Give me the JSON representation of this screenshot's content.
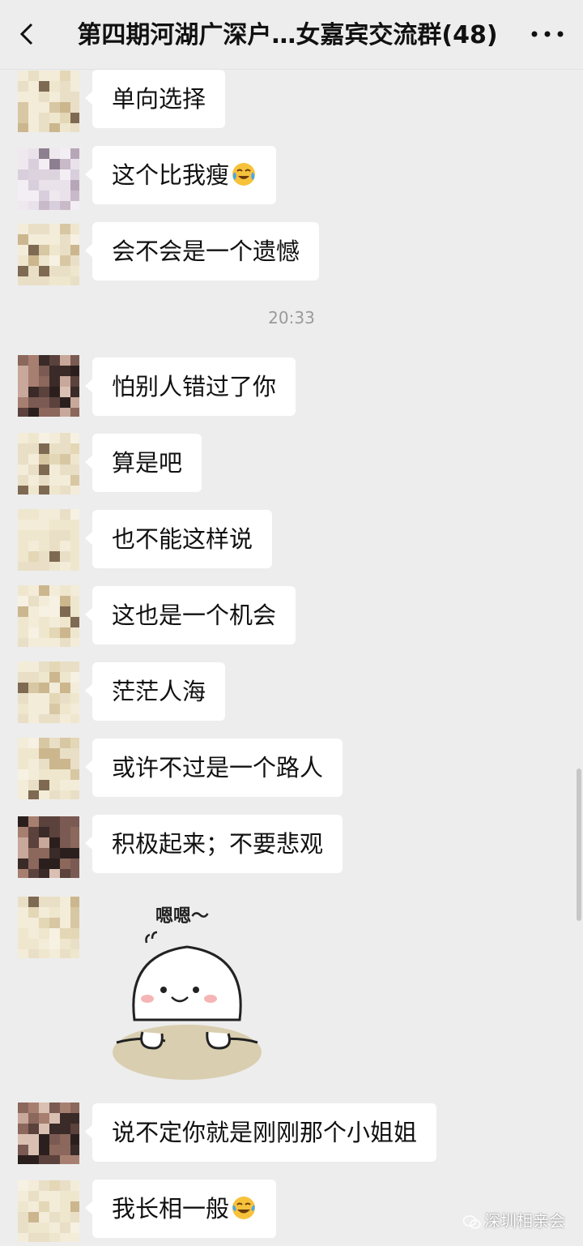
{
  "header": {
    "title": "第四期河湖广深户…女嘉宾交流群(48)"
  },
  "timestamp": "20:33",
  "messages": [
    {
      "text": "单向选择",
      "avatar": "beige"
    },
    {
      "text": "这个比我瘦",
      "emoji": "crying-laugh-emoji",
      "avatar": "lavender"
    },
    {
      "text": "会不会是一个遗憾",
      "avatar": "beige"
    },
    {
      "text": "怕别人错过了你",
      "avatar": "dark"
    },
    {
      "text": "算是吧",
      "avatar": "beige"
    },
    {
      "text": "也不能这样说",
      "avatar": "beige"
    },
    {
      "text": "这也是一个机会",
      "avatar": "beige"
    },
    {
      "text": "茫茫人海",
      "avatar": "beige"
    },
    {
      "text": "或许不过是一个路人",
      "avatar": "beige"
    },
    {
      "text": "积极起来；不要悲观",
      "avatar": "dark"
    },
    {
      "sticker_caption": "嗯嗯～",
      "sticker": "smiling-bun-sticker",
      "avatar": "beige"
    },
    {
      "text": "说不定你就是刚刚那个小姐姐",
      "avatar": "dark"
    },
    {
      "text": "我长相一般",
      "emoji": "tears-of-joy-emoji",
      "avatar": "beige"
    }
  ],
  "watermark": "深圳相亲会",
  "colors": {
    "background": "#ededed",
    "bubble": "#ffffff",
    "text": "#111111"
  }
}
